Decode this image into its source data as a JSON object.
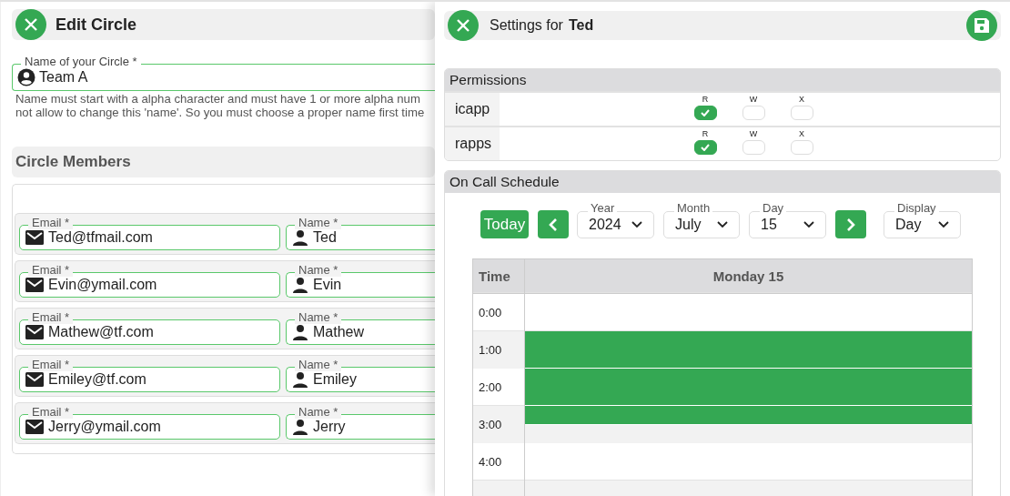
{
  "edit_circle": {
    "title": "Edit Circle",
    "circle_name": {
      "label": "Name of your Circle *",
      "value": "Team A"
    },
    "hint_lines": [
      "Name must start with a alpha character and must have 1 or more alpha num",
      "not allow to change this 'name'. So you must choose a proper name first time"
    ],
    "members_title": "Circle Members",
    "members": [
      {
        "email_label": "Email *",
        "email": "Ted@tfmail.com",
        "name_label": "Name *",
        "name": "Ted"
      },
      {
        "email_label": "Email *",
        "email": "Evin@ymail.com",
        "name_label": "Name *",
        "name": "Evin"
      },
      {
        "email_label": "Email *",
        "email": "Mathew@tf.com",
        "name_label": "Name *",
        "name": "Mathew"
      },
      {
        "email_label": "Email *",
        "email": "Emiley@tf.com",
        "name_label": "Name *",
        "name": "Emiley"
      },
      {
        "email_label": "Email *",
        "email": "Jerry@ymail.com",
        "name_label": "Name *",
        "name": "Jerry"
      }
    ]
  },
  "settings": {
    "title": "Settings for",
    "person": "Ted",
    "permissions": {
      "title": "Permissions",
      "apps": [
        {
          "name": "icapp",
          "flags": [
            {
              "label": "R",
              "checked": true
            },
            {
              "label": "W",
              "checked": false
            },
            {
              "label": "X",
              "checked": false
            }
          ]
        },
        {
          "name": "rapps",
          "flags": [
            {
              "label": "R",
              "checked": true
            },
            {
              "label": "W",
              "checked": false
            },
            {
              "label": "X",
              "checked": false
            }
          ]
        }
      ]
    },
    "schedule": {
      "title": "On Call Schedule",
      "today": "Today",
      "selects": [
        {
          "label": "Year",
          "value": "2024"
        },
        {
          "label": "Month",
          "value": "July"
        },
        {
          "label": "Day",
          "value": "15"
        }
      ],
      "display": {
        "label": "Display",
        "value": "Day"
      },
      "time_header": "Time",
      "day_header": "Monday 15",
      "hours": [
        {
          "time": "0:00",
          "first_half_booked": false,
          "second_half_booked": false
        },
        {
          "time": "1:00",
          "first_half_booked": true,
          "second_half_booked": true
        },
        {
          "time": "2:00",
          "first_half_booked": true,
          "second_half_booked": true
        },
        {
          "time": "3:00",
          "first_half_booked": true,
          "second_half_booked": false
        },
        {
          "time": "4:00",
          "first_half_booked": false,
          "second_half_booked": false
        }
      ]
    }
  }
}
